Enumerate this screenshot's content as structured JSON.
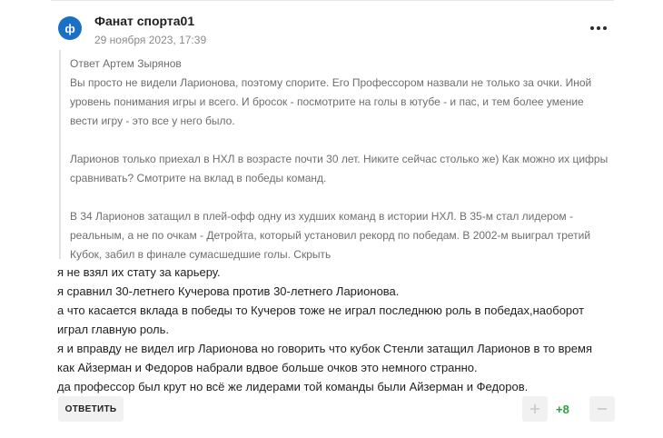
{
  "comment": {
    "avatar_letter": "ф",
    "author": "Фанат спорта01",
    "date": "29 ноября 2023, 17:39",
    "quote": {
      "header": "Ответ Артем Зырянов",
      "paragraphs": [
        "Вы просто не видели Ларионова, поэтому спорите. Его Профессором назвали не только за очки. Иной уровень понимания игры и всего. И бросок - посмотрите на голы в ютубе - и пас, и тем более умение вести игру - это все у него было.",
        "Ларионов только приехал в НХЛ в возрасте почти 30 лет. Никите сейчас столько же) Как можно их цифры сравнивать? Смотрите на вклад в победы команд.",
        "В 34 Ларионов затащил в плей-офф одну из худших команд в истории НХЛ. В 35-м стал лидером - реальным, а не по очкам - Детройта, который установил рекорд по победам. В 2002-м выиграл третий Кубок, забил в финале сумасшедшие голы."
      ],
      "hide_label": "Скрыть"
    },
    "body_lines": [
      "я не взял их стату за карьеру.",
      "я сравнил 30-летнего Кучерова против 30-летнего Ларионова.",
      "а что касается вклада в победы то Кучеров тоже не играл последнюю роль в победах,наоборот играл главную роль.",
      "я и вправду не видел игр Ларионова но говорить что кубок Стенли затащил Ларионов в то время как Айзерман и Федоров набрали вдвое больше очков это немного странно.",
      "да профессор был крут но всё же лидерами той команды были Айзерман и Федоров."
    ],
    "reply_label": "ОТВЕТИТЬ",
    "score": "+8",
    "colors": {
      "avatar": "#1b6fc4",
      "score": "#2e9e3c"
    },
    "icons": {
      "more": "more-dots-icon",
      "up": "plus-icon",
      "down": "minus-icon"
    }
  }
}
